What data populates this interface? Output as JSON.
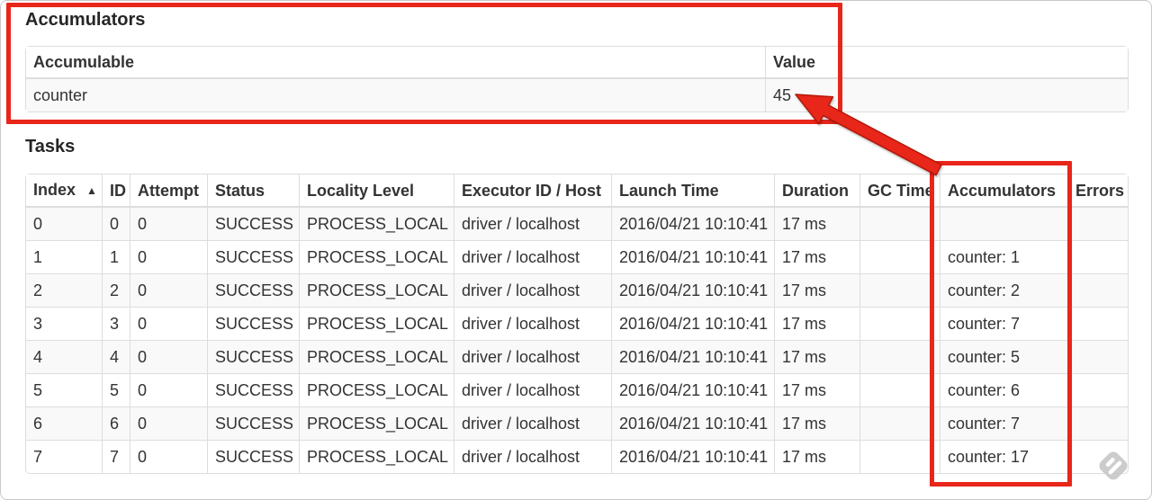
{
  "accumulators_section": {
    "title": "Accumulators",
    "table": {
      "columns": [
        "Accumulable",
        "Value"
      ],
      "rows": [
        {
          "accumulable": "counter",
          "value": "45"
        }
      ]
    }
  },
  "tasks_section": {
    "title": "Tasks",
    "table": {
      "columns": [
        "Index",
        "ID",
        "Attempt",
        "Status",
        "Locality Level",
        "Executor ID / Host",
        "Launch Time",
        "Duration",
        "GC Time",
        "Accumulators",
        "Errors"
      ],
      "sort_icon": "▲",
      "sorted_column": "Index",
      "rows": [
        {
          "index": "0",
          "id": "0",
          "attempt": "0",
          "status": "SUCCESS",
          "locality_level": "PROCESS_LOCAL",
          "executor_id_host": "driver / localhost",
          "launch_time": "2016/04/21 10:10:41",
          "duration": "17 ms",
          "gc_time": "",
          "accumulators": "",
          "errors": ""
        },
        {
          "index": "1",
          "id": "1",
          "attempt": "0",
          "status": "SUCCESS",
          "locality_level": "PROCESS_LOCAL",
          "executor_id_host": "driver / localhost",
          "launch_time": "2016/04/21 10:10:41",
          "duration": "17 ms",
          "gc_time": "",
          "accumulators": "counter: 1",
          "errors": ""
        },
        {
          "index": "2",
          "id": "2",
          "attempt": "0",
          "status": "SUCCESS",
          "locality_level": "PROCESS_LOCAL",
          "executor_id_host": "driver / localhost",
          "launch_time": "2016/04/21 10:10:41",
          "duration": "17 ms",
          "gc_time": "",
          "accumulators": "counter: 2",
          "errors": ""
        },
        {
          "index": "3",
          "id": "3",
          "attempt": "0",
          "status": "SUCCESS",
          "locality_level": "PROCESS_LOCAL",
          "executor_id_host": "driver / localhost",
          "launch_time": "2016/04/21 10:10:41",
          "duration": "17 ms",
          "gc_time": "",
          "accumulators": "counter: 7",
          "errors": ""
        },
        {
          "index": "4",
          "id": "4",
          "attempt": "0",
          "status": "SUCCESS",
          "locality_level": "PROCESS_LOCAL",
          "executor_id_host": "driver / localhost",
          "launch_time": "2016/04/21 10:10:41",
          "duration": "17 ms",
          "gc_time": "",
          "accumulators": "counter: 5",
          "errors": ""
        },
        {
          "index": "5",
          "id": "5",
          "attempt": "0",
          "status": "SUCCESS",
          "locality_level": "PROCESS_LOCAL",
          "executor_id_host": "driver / localhost",
          "launch_time": "2016/04/21 10:10:41",
          "duration": "17 ms",
          "gc_time": "",
          "accumulators": "counter: 6",
          "errors": ""
        },
        {
          "index": "6",
          "id": "6",
          "attempt": "0",
          "status": "SUCCESS",
          "locality_level": "PROCESS_LOCAL",
          "executor_id_host": "driver / localhost",
          "launch_time": "2016/04/21 10:10:41",
          "duration": "17 ms",
          "gc_time": "",
          "accumulators": "counter: 7",
          "errors": ""
        },
        {
          "index": "7",
          "id": "7",
          "attempt": "0",
          "status": "SUCCESS",
          "locality_level": "PROCESS_LOCAL",
          "executor_id_host": "driver / localhost",
          "launch_time": "2016/04/21 10:10:41",
          "duration": "17 ms",
          "gc_time": "",
          "accumulators": "counter: 17",
          "errors": ""
        }
      ]
    }
  },
  "annotations": {
    "highlight_color": "#e8261a",
    "box_1_target": "accumulators-summary-table",
    "box_2_target": "accumulators-column",
    "arrow_points_to": "45"
  },
  "colors": {
    "table_border": "#dddddd",
    "striped_row": "#f9f9f9",
    "text": "#333333",
    "watermark_gray": "#c6c6c6"
  }
}
